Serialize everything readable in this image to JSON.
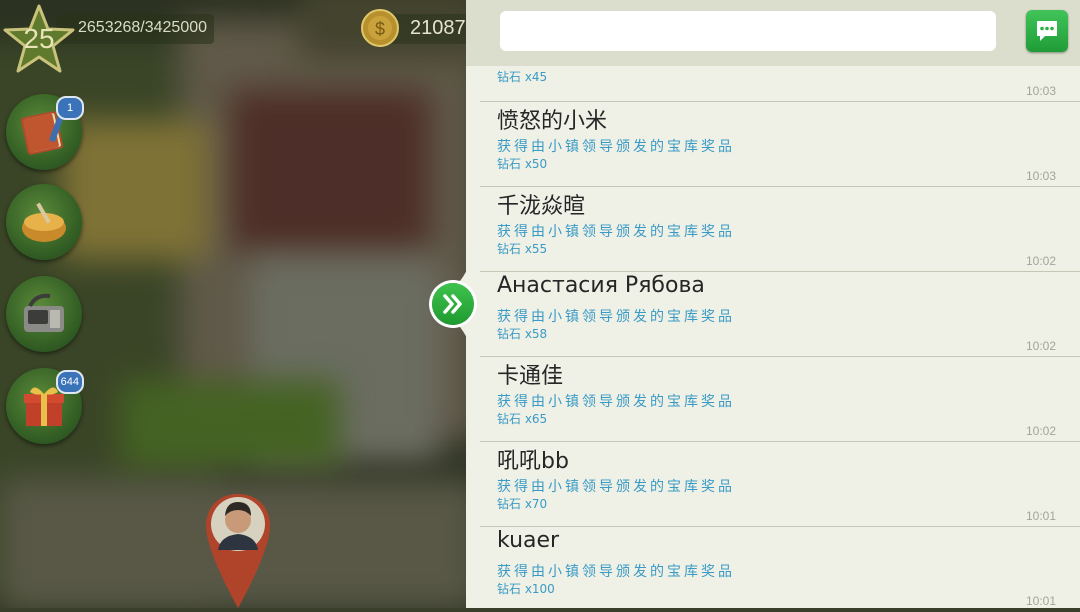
{
  "hud": {
    "level": "25",
    "xp": "2653268/3425000",
    "coins": "21087"
  },
  "side_buttons": [
    {
      "name": "book-icon",
      "badge": "1"
    },
    {
      "name": "bowl-icon",
      "badge": ""
    },
    {
      "name": "phone-icon",
      "badge": ""
    },
    {
      "name": "gift-icon",
      "badge": "644"
    }
  ],
  "chat": {
    "input_placeholder": "",
    "top_partial": {
      "reward": "钻石 x45",
      "time": "10:03"
    },
    "messages": [
      {
        "name": "愤怒的小米",
        "action": "获得由小镇领导颁发的宝库奖品",
        "reward": "钻石 x50",
        "time": "10:03"
      },
      {
        "name": "千泷焱暄",
        "action": "获得由小镇领导颁发的宝库奖品",
        "reward": "钻石 x55",
        "time": "10:02"
      },
      {
        "name": "Анастасия Рябова",
        "action": "获得由小镇领导颁发的宝库奖品",
        "reward": "钻石 x58",
        "time": "10:02"
      },
      {
        "name": "卡通佳",
        "action": "获得由小镇领导颁发的宝库奖品",
        "reward": "钻石 x65",
        "time": "10:02"
      },
      {
        "name": "吼吼bb",
        "action": "获得由小镇领导颁发的宝库奖品",
        "reward": "钻石 x70",
        "time": "10:01"
      },
      {
        "name": "kuaer",
        "action": "获得由小镇领导颁发的宝库奖品",
        "reward": "钻石 x100",
        "time": "10:01"
      }
    ]
  },
  "colors": {
    "accent_green": "#2fb043",
    "message_blue": "#3a9bc6",
    "panel_bg": "#eff0e6"
  }
}
